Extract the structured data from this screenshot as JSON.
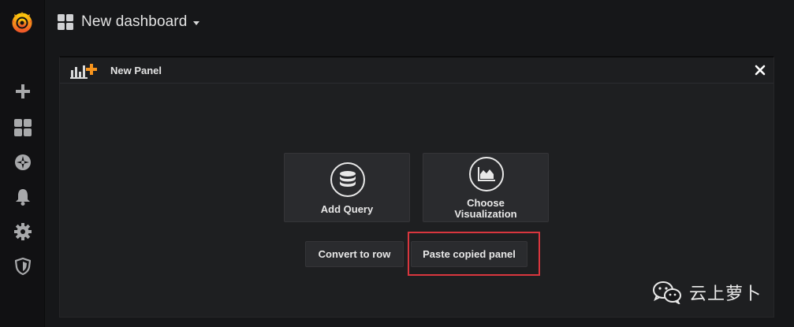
{
  "sidebar": {
    "logo": "grafana-logo-icon",
    "items": [
      {
        "name": "plus-icon",
        "label": "Create"
      },
      {
        "name": "dashboards-icon",
        "label": "Dashboards"
      },
      {
        "name": "explore-compass-icon",
        "label": "Explore"
      },
      {
        "name": "bell-icon",
        "label": "Alerting"
      },
      {
        "name": "gear-icon",
        "label": "Configuration"
      },
      {
        "name": "shield-icon",
        "label": "Server Admin"
      }
    ]
  },
  "header": {
    "dashboard_title": "New dashboard"
  },
  "panel": {
    "title": "New Panel",
    "add_query_label": "Add Query",
    "choose_viz_line1": "Choose",
    "choose_viz_line2": "Visualization",
    "convert_to_row_label": "Convert to row",
    "paste_panel_label": "Paste copied panel"
  },
  "watermark": {
    "text": "云上萝卜"
  },
  "colors": {
    "accent_orange": "#f7941d",
    "highlight_red": "#d9363e",
    "background": "#161719",
    "panel_bg": "#1e1f21"
  }
}
